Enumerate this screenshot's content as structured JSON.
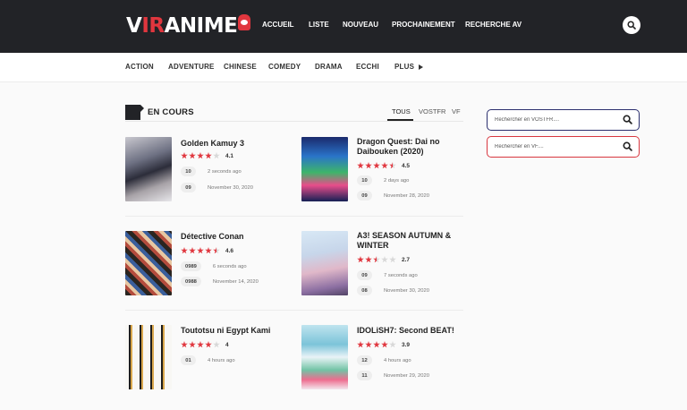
{
  "header": {
    "logo": {
      "part1": "V",
      "part2": "IR",
      "part3": "ANIME"
    },
    "nav": [
      {
        "label": "ACCUEIL"
      },
      {
        "label": "LISTE"
      },
      {
        "label": "NOUVEAU"
      },
      {
        "label": "PROCHAINEMENT"
      },
      {
        "label": "RECHERCHE AV"
      }
    ],
    "search_icon": "search-icon"
  },
  "genres": [
    {
      "label": "ACTION"
    },
    {
      "label": "ADVENTURE"
    },
    {
      "label": "CHINESE"
    },
    {
      "label": "COMEDY"
    },
    {
      "label": "DRAMA"
    },
    {
      "label": "ECCHI"
    },
    {
      "label": "PLUS"
    }
  ],
  "section": {
    "title": "EN COURS",
    "tabs": [
      {
        "label": "TOUS"
      },
      {
        "label": "VOSTFR"
      },
      {
        "label": "VF"
      }
    ],
    "active_tab": "TOUS"
  },
  "items": [
    {
      "title": "Golden Kamuy 3",
      "rating": 4.1,
      "rating_label": "4.1",
      "episodes": [
        {
          "num": "10",
          "time": "2 seconds ago"
        },
        {
          "num": "09",
          "time": "November 30, 2020"
        }
      ]
    },
    {
      "title": "Dragon Quest: Dai no Daibouken (2020)",
      "rating": 4.5,
      "rating_label": "4.5",
      "episodes": [
        {
          "num": "10",
          "time": "2 days ago"
        },
        {
          "num": "09",
          "time": "November 28, 2020"
        }
      ]
    },
    {
      "title": "Détective Conan",
      "rating": 4.6,
      "rating_label": "4.6",
      "episodes": [
        {
          "num": "0989",
          "time": "6 seconds ago"
        },
        {
          "num": "0988",
          "time": "November 14, 2020"
        }
      ]
    },
    {
      "title": "A3! SEASON AUTUMN & WINTER",
      "rating": 2.7,
      "rating_label": "2.7",
      "episodes": [
        {
          "num": "09",
          "time": "7 seconds ago"
        },
        {
          "num": "08",
          "time": "November 30, 2020"
        }
      ]
    },
    {
      "title": "Toutotsu ni Egypt Kami",
      "rating": 4,
      "rating_label": "4",
      "episodes": [
        {
          "num": "01",
          "time": "4 hours ago"
        }
      ]
    },
    {
      "title": "IDOLiSH7: Second BEAT!",
      "rating": 3.9,
      "rating_label": "3.9",
      "episodes": [
        {
          "num": "12",
          "time": "4 hours ago"
        },
        {
          "num": "11",
          "time": "November 29, 2020"
        }
      ]
    }
  ],
  "sidebar": {
    "search_vostfr_placeholder": "Rechercher en VOSTFR....",
    "search_vf_placeholder": "Rechercher en VF...."
  },
  "colors": {
    "accent": "#e0363e",
    "header_bg": "#222327",
    "vostfr_border": "#2b2f6e",
    "vf_border": "#d8373f"
  }
}
